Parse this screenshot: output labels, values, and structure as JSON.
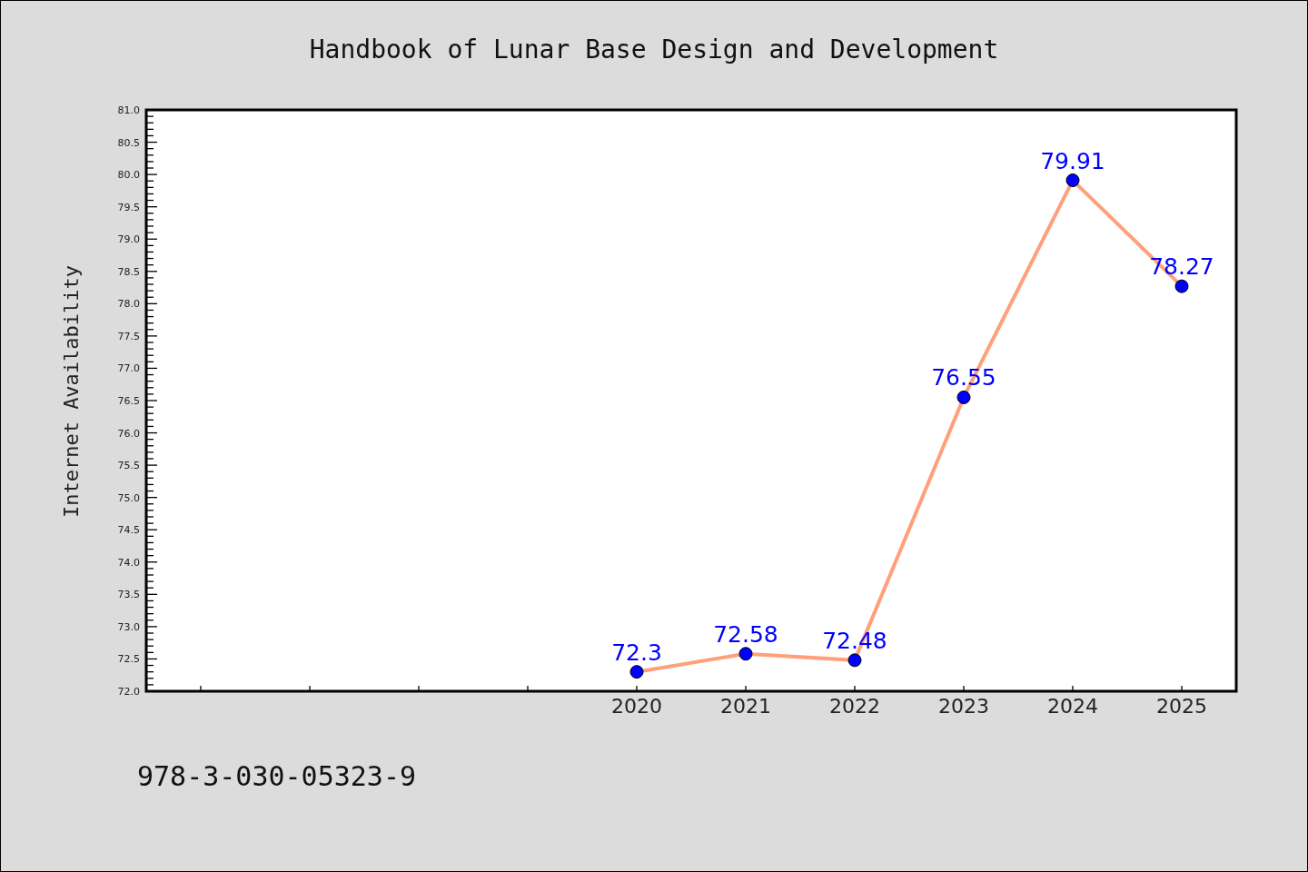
{
  "chart_data": {
    "type": "line",
    "title": "Handbook of Lunar Base Design and Development",
    "ylabel": "Internet Availability",
    "x": [
      2020,
      2021,
      2022,
      2023,
      2024,
      2025
    ],
    "series": [
      {
        "color": "#ffa07a",
        "marker": "circle",
        "values": [
          72.3,
          72.58,
          72.48,
          76.55,
          79.91,
          78.27
        ]
      }
    ],
    "xlim": [
      2015.5,
      2025.5
    ],
    "ylim": [
      72,
      81
    ],
    "xticks": [
      2020,
      2021,
      2022,
      2023,
      2024,
      2025
    ],
    "yticks": [
      {
        "value": 72,
        "label": "72.0"
      },
      {
        "value": 72.5,
        "label": "72.5"
      },
      {
        "value": 73,
        "label": "73.0"
      },
      {
        "value": 73.5,
        "label": "73.5"
      },
      {
        "value": 74,
        "label": "74.0"
      },
      {
        "value": 74.5,
        "label": "74.5"
      },
      {
        "value": 75,
        "label": "75.0"
      },
      {
        "value": 75.5,
        "label": "75.5"
      },
      {
        "value": 76,
        "label": "76.0"
      },
      {
        "value": 76.5,
        "label": "76.5"
      },
      {
        "value": 77,
        "label": "77.0"
      },
      {
        "value": 77.5,
        "label": "77.5"
      },
      {
        "value": 78,
        "label": "78.0"
      },
      {
        "value": 78.5,
        "label": "78.5"
      },
      {
        "value": 79,
        "label": "79.0"
      },
      {
        "value": 79.5,
        "label": "79.5"
      },
      {
        "value": 80,
        "label": "80.0"
      },
      {
        "value": 80.5,
        "label": "80.5"
      },
      {
        "value": 81,
        "label": "81.0"
      }
    ],
    "data_labels": true
  },
  "isbn": "978-3-030-05323-9"
}
